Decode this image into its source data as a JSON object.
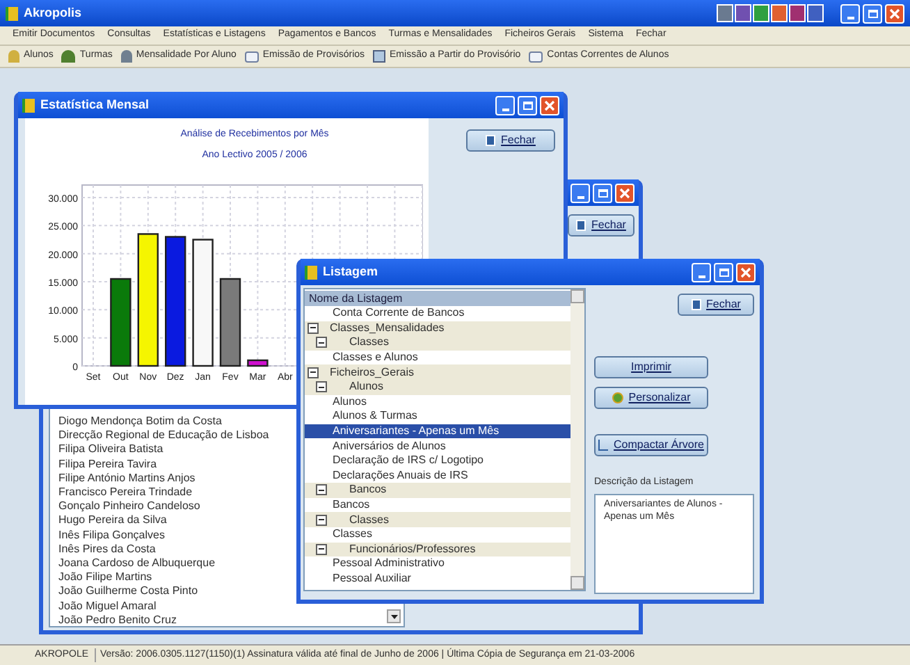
{
  "app": {
    "title": "Akropolis"
  },
  "menu": [
    "Emitir Documentos",
    "Consultas",
    "Estatísticas e Listagens",
    "Pagamentos e Bancos",
    "Turmas e Mensalidades",
    "Ficheiros Gerais",
    "Sistema",
    "Fechar"
  ],
  "toolbar": [
    {
      "label": "Alunos",
      "kind": "people"
    },
    {
      "label": "Turmas",
      "kind": "group"
    },
    {
      "label": "Mensalidade Por Aluno",
      "kind": "person"
    },
    {
      "label": "Emissão de Provisórios",
      "kind": "document"
    },
    {
      "label": "Emissão a Partir do Provisório",
      "kind": "sheet"
    },
    {
      "label": "Contas Correntes de Alunos",
      "kind": "document"
    }
  ],
  "chart_window": {
    "title": "Estatística Mensal",
    "close_button": "Fechar",
    "subtitle": "Ano Lectivo 2005 / 2006",
    "chart_data": {
      "type": "bar",
      "title": "Análise de Recebimentos por Mês",
      "categories": [
        "Set",
        "Out",
        "Nov",
        "Dez",
        "Jan",
        "Fev",
        "Mar",
        "Abr"
      ],
      "grid": true,
      "series": [
        {
          "values": [
            0,
            15500,
            23500,
            23000,
            22500,
            15500,
            1000,
            0
          ]
        }
      ],
      "ylim": [
        0,
        30000
      ],
      "yticks": [
        {
          "value": 0,
          "label": "0"
        },
        {
          "value": 5000,
          "label": "5.000"
        },
        {
          "value": 10000,
          "label": "10.000"
        },
        {
          "value": 15000,
          "label": "15.000"
        },
        {
          "value": 20000,
          "label": "20.000"
        },
        {
          "value": 25000,
          "label": "25.000"
        },
        {
          "value": 30000,
          "label": "30.000"
        }
      ]
    }
  },
  "names_window": {
    "close_button": "Fechar",
    "names": [
      "Diogo Mendonça Botim da Costa",
      "Direcção Regional de Educação de Lisboa",
      "Filipa Oliveira Batista",
      "Filipa Pereira Tavira",
      "Filipe António Martins Anjos",
      "Francisco Pereira Trindade",
      "Gonçalo Pinheiro Candeloso",
      "Hugo Pereira da Silva",
      "Inês Filipa Gonçalves",
      "Inês Pires da Costa",
      "Joana Cardoso de Albuquerque",
      "João Filipe Martins",
      "João Guilherme Costa Pinto",
      "João Miguel Amaral",
      "João Pedro Benito Cruz"
    ]
  },
  "listing_window": {
    "title": "Listagem",
    "tree_header": "Nome da Listagem",
    "tree": [
      {
        "label": "Conta Corrente de Bancos",
        "selected": false
      },
      {
        "label": "Classes_Mensalidades",
        "expanded": true,
        "children": [
          {
            "label": "Classes",
            "expanded": true,
            "children": [
              {
                "label": "Classes e Alunos",
                "selected": false
              }
            ]
          }
        ]
      },
      {
        "label": "Ficheiros_Gerais",
        "expanded": true,
        "children": [
          {
            "label": "Alunos",
            "expanded": true,
            "children": [
              {
                "label": "Alunos",
                "selected": false
              },
              {
                "label": "Alunos & Turmas",
                "selected": false
              },
              {
                "label": "Aniversariantes - Apenas um Mês",
                "selected": true
              },
              {
                "label": "Aniversários de Alunos",
                "selected": false
              },
              {
                "label": "Declaração de IRS c/ Logotipo",
                "selected": false
              },
              {
                "label": "Declarações Anuais de IRS",
                "selected": false
              }
            ]
          },
          {
            "label": "Bancos",
            "expanded": true,
            "children": [
              {
                "label": "Bancos",
                "selected": false
              }
            ]
          },
          {
            "label": "Classes",
            "expanded": true,
            "children": [
              {
                "label": "Classes",
                "selected": false
              }
            ]
          },
          {
            "label": "Funcionários/Professores",
            "expanded": true,
            "children": [
              {
                "label": "Pessoal Administrativo",
                "selected": false
              },
              {
                "label": "Pessoal Auxiliar",
                "selected": false
              }
            ]
          }
        ]
      }
    ],
    "close_button": "Fechar",
    "print_button": "Imprimir",
    "customize_button": "Personalizar",
    "collapse_button": "Compactar Árvore",
    "description_label": "Descrição da Listagem",
    "description": "Aniversariantes de Alunos - Apenas um Mês"
  },
  "status_bar": {
    "app": "AKROPOLE",
    "info": "Versão: 2006.0305.1127(1150)(1)  Assinatura válida até final de Junho de 2006 | Última Cópia de Segurança em 21-03-2006"
  }
}
